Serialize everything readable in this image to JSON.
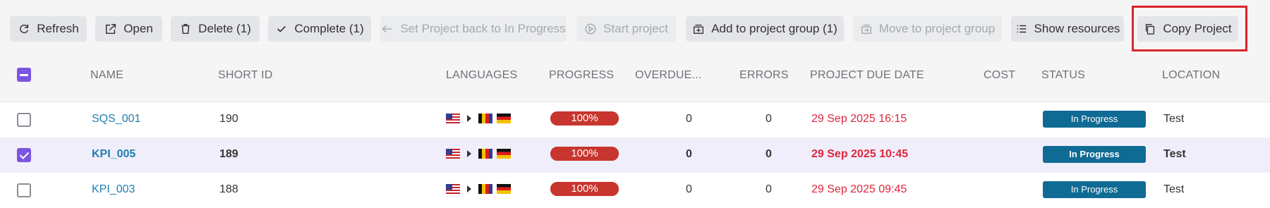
{
  "toolbar": {
    "buttons": [
      {
        "label": "Refresh",
        "icon": "refresh-icon",
        "enabled": true
      },
      {
        "label": "Open",
        "icon": "open-icon",
        "enabled": true
      },
      {
        "label": "Delete (1)",
        "icon": "trash-icon",
        "enabled": true
      },
      {
        "label": "Complete (1)",
        "icon": "check-icon",
        "enabled": true
      },
      {
        "label": "Set Project back to In Progress",
        "icon": "arrow-left-icon",
        "enabled": false
      },
      {
        "label": "Start project",
        "icon": "play-icon",
        "enabled": false
      },
      {
        "label": "Add to project group (1)",
        "icon": "add-group-icon",
        "enabled": true
      },
      {
        "label": "Move to project group",
        "icon": "move-group-icon",
        "enabled": false
      },
      {
        "label": "Show resources",
        "icon": "list-icon",
        "enabled": true
      },
      {
        "label": "Copy Project",
        "icon": "copy-icon",
        "enabled": true,
        "highlighted": true
      }
    ]
  },
  "table": {
    "columns": [
      "NAME",
      "SHORT ID",
      "LANGUAGES",
      "PROGRESS",
      "OVERDUE...",
      "ERRORS",
      "PROJECT DUE DATE",
      "COST",
      "STATUS",
      "LOCATION"
    ],
    "rows": [
      {
        "name": "SQS_001",
        "short_id": "190",
        "progress": "100%",
        "progress_value": 1.0,
        "overdue": "0",
        "errors": "0",
        "due_date": "29 Sep 2025 16:15",
        "cost": "",
        "status": "In Progress",
        "location": "Test",
        "selected": false
      },
      {
        "name": "KPI_005",
        "short_id": "189",
        "progress": "100%",
        "progress_value": 1.0,
        "overdue": "0",
        "errors": "0",
        "due_date": "29 Sep 2025 10:45",
        "cost": "",
        "status": "In Progress",
        "location": "Test",
        "selected": true
      },
      {
        "name": "KPI_003",
        "short_id": "188",
        "progress": "100%",
        "progress_value": 1.0,
        "overdue": "0",
        "errors": "0",
        "due_date": "29 Sep 2025 09:45",
        "cost": "",
        "status": "In Progress",
        "location": "Test",
        "selected": false
      }
    ]
  },
  "colors": {
    "accent": "#7b55e0",
    "link": "#1f7fb0",
    "due_date": "#e0263c",
    "progress": "#c8352e",
    "status": "#0f6b94",
    "highlight": "#d9262c"
  }
}
